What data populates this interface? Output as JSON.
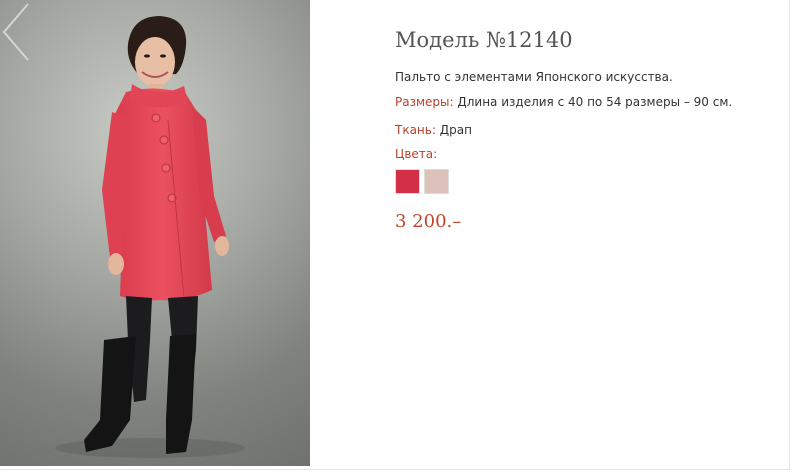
{
  "product": {
    "title": "Модель №12140",
    "description": "Пальто с элементами Японского искусства.",
    "sizes_label": "Размеры:",
    "sizes_value": " Длина изделия с 40 по 54 размеры – 90 см.",
    "fabric_label": "Ткань:",
    "fabric_value": " Драп",
    "colors_label": "Цвета:",
    "price": "3 200.–"
  },
  "swatches": [
    {
      "name": "red",
      "color": "#d22f48"
    },
    {
      "name": "beige",
      "color": "#dcc2bb"
    }
  ],
  "colors": {
    "accent": "#b8412a",
    "price": "#c0462c",
    "coat": "#e5495a"
  },
  "icons": {
    "prev": "chevron-left-icon"
  }
}
